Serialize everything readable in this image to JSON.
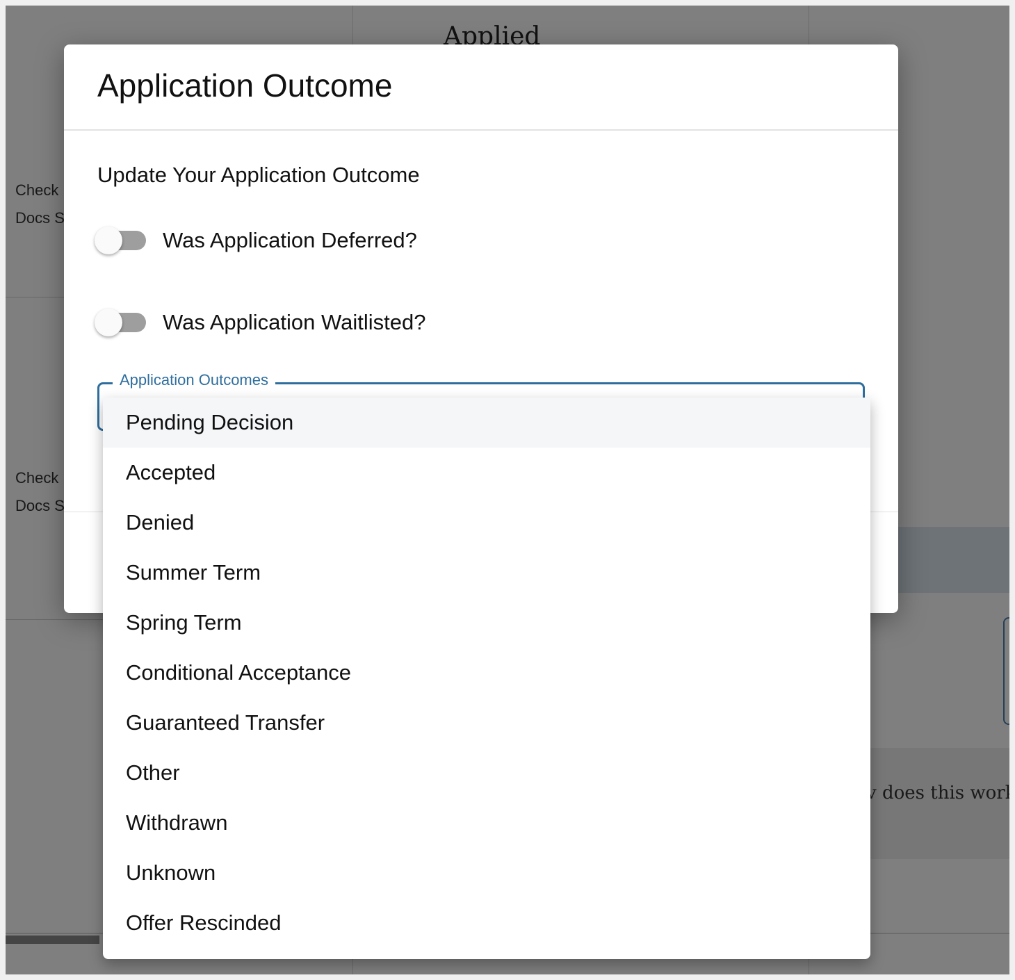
{
  "background": {
    "column_heading": "Applied",
    "card_line1": "Check",
    "card_line2": "Docs S",
    "help_text": "v does this work"
  },
  "dialog": {
    "title": "Application Outcome",
    "subtitle": "Update Your Application Outcome",
    "toggles": {
      "deferred": {
        "label": "Was Application Deferred?",
        "checked": false
      },
      "waitlisted": {
        "label": "Was Application Waitlisted?",
        "checked": false
      }
    },
    "select": {
      "label": "Application Outcomes",
      "selected": "Pending Decision",
      "options": [
        "Pending Decision",
        "Accepted",
        "Denied",
        "Summer Term",
        "Spring Term",
        "Conditional Acceptance",
        "Guaranteed Transfer",
        "Other",
        "Withdrawn",
        "Unknown",
        "Offer Rescinded"
      ]
    }
  },
  "colors": {
    "accent": "#2e6e9e",
    "toggle_off_track": "#9e9e9e",
    "selected_option_bg": "#f5f6f8",
    "overlay": "rgba(0,0,0,0.5)"
  }
}
